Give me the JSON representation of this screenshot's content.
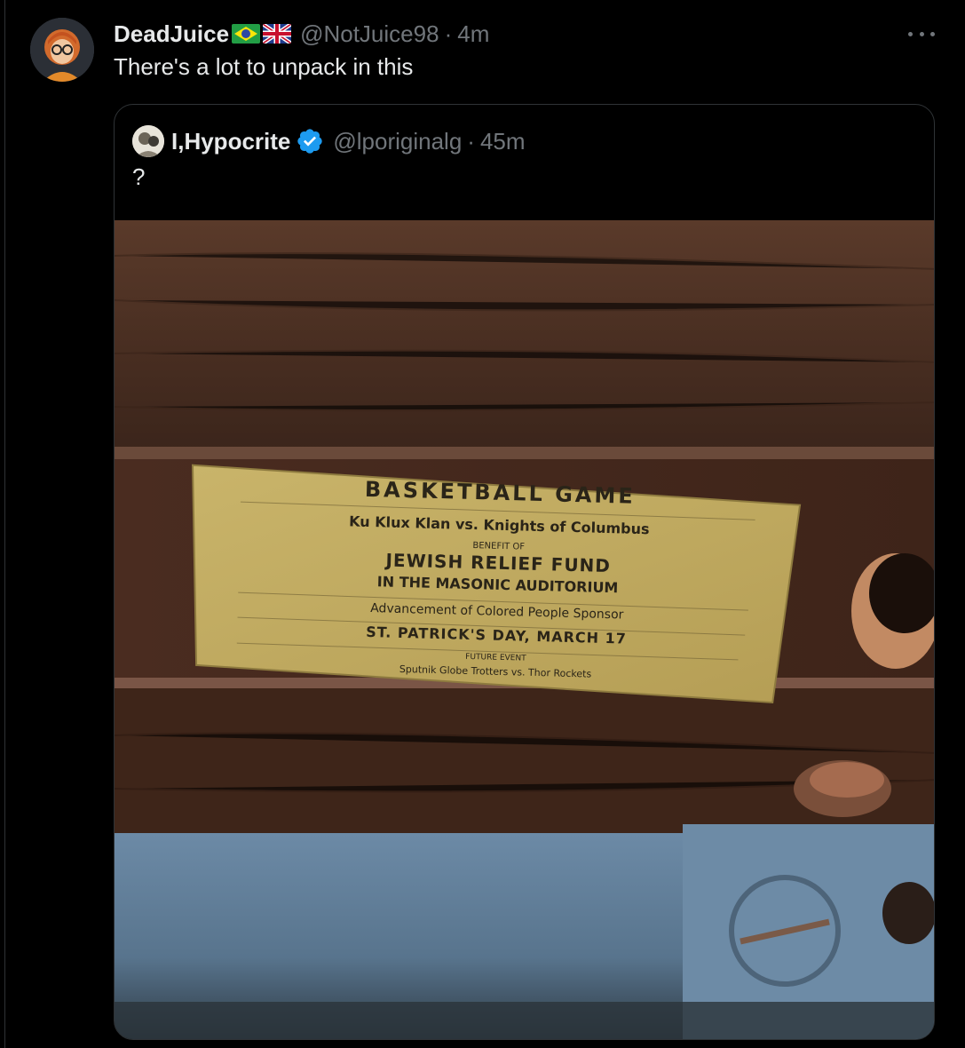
{
  "tweet": {
    "display_name": "DeadJuice",
    "flags": [
      "brazil-flag",
      "uk-flag"
    ],
    "handle": "@NotJuice98",
    "separator": "·",
    "time": "4m",
    "text": "There's a lot to unpack in this"
  },
  "quoted_tweet": {
    "display_name": "I,Hypocrite",
    "verified": true,
    "handle": "@lporiginalg",
    "separator": "·",
    "time": "45m",
    "text": "?",
    "photo_label": {
      "title": "BASKETBALL GAME",
      "line1": "Ku Klux Klan vs. Knights of Columbus",
      "line2": "BENEFIT OF",
      "line3": "JEWISH RELIEF FUND",
      "line4": "IN THE MASONIC AUDITORIUM",
      "line5": "Advancement of Colored People Sponsor",
      "line6": "ST. PATRICK'S DAY, MARCH 17",
      "line7": "FUTURE EVENT",
      "line8": "Sputnik Globe Trotters vs. Thor Rockets"
    }
  },
  "icons": {
    "more": "more-icon",
    "verified": "verified-badge-icon"
  },
  "colors": {
    "background": "#000000",
    "text_primary": "#e7e9ea",
    "text_secondary": "#71767b",
    "border": "#2f3336",
    "verified_blue": "#1d9bf0"
  }
}
